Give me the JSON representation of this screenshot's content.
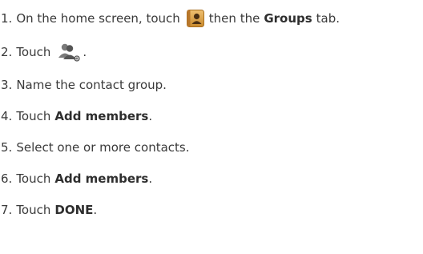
{
  "steps": [
    {
      "number": "1.",
      "text_before_icon": "On the home screen, touch",
      "icon": "contacts-app-icon",
      "text_after_icon": "then the",
      "bold": "Groups",
      "text_after_bold": "tab."
    },
    {
      "number": "2.",
      "text_before_icon": "Touch",
      "icon": "new-group-icon",
      "text_after_icon": "."
    },
    {
      "number": "3.",
      "text": "Name the contact group."
    },
    {
      "number": "4.",
      "text_before_bold": "Touch",
      "bold": "Add members",
      "text_after_bold": "."
    },
    {
      "number": "5.",
      "text": "Select one or more contacts."
    },
    {
      "number": "6.",
      "text_before_bold": "Touch",
      "bold": "Add members",
      "text_after_bold": "."
    },
    {
      "number": "7.",
      "text_before_bold": "Touch",
      "bold": "DONE",
      "text_after_bold": "."
    }
  ],
  "colors": {
    "text": "#3a3a3a",
    "contacts_icon_bg": "#d59a3c",
    "contacts_icon_person": "#4a2f12",
    "group_icon": "#6a6a6a"
  }
}
